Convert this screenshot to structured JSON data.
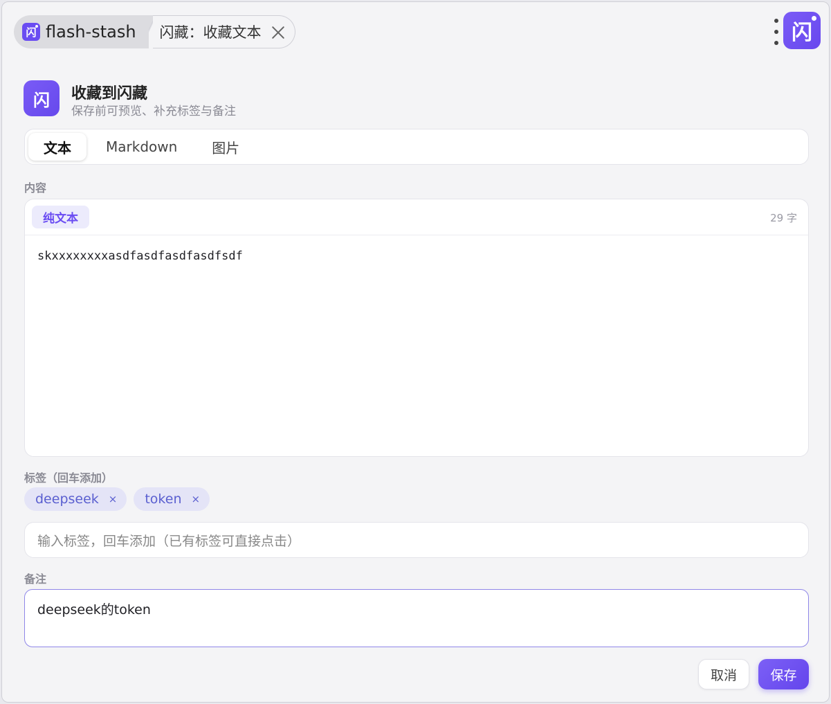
{
  "titlebar": {
    "app_icon_glyph": "闪",
    "app_name": "flash-stash",
    "page_tab": "闪藏：收藏文本",
    "badge_glyph": "闪"
  },
  "header": {
    "logo_glyph": "闪",
    "title": "收藏到闪藏",
    "subtitle": "保存前可预览、补充标签与备注"
  },
  "type_tabs": [
    {
      "label": "文本",
      "active": true
    },
    {
      "label": "Markdown",
      "active": false
    },
    {
      "label": "图片",
      "active": false
    }
  ],
  "content": {
    "section_label": "内容",
    "format": "纯文本",
    "char_count": "29 字",
    "text": "skxxxxxxxxasdfasdfasdfasdfsdf"
  },
  "tags": {
    "section_label": "标签（回车添加）",
    "items": [
      "deepseek",
      "token"
    ],
    "remove_glyph": "×",
    "input_placeholder": "输入标签，回车添加（已有标签可直接点击）"
  },
  "note": {
    "section_label": "备注",
    "value": "deepseek的token"
  },
  "footer": {
    "cancel_label": "取消",
    "save_label": "保存"
  },
  "colors": {
    "accent": "#6a4cf2",
    "tag_bg": "#e4e4f7",
    "tag_text": "#5a5fd0"
  }
}
